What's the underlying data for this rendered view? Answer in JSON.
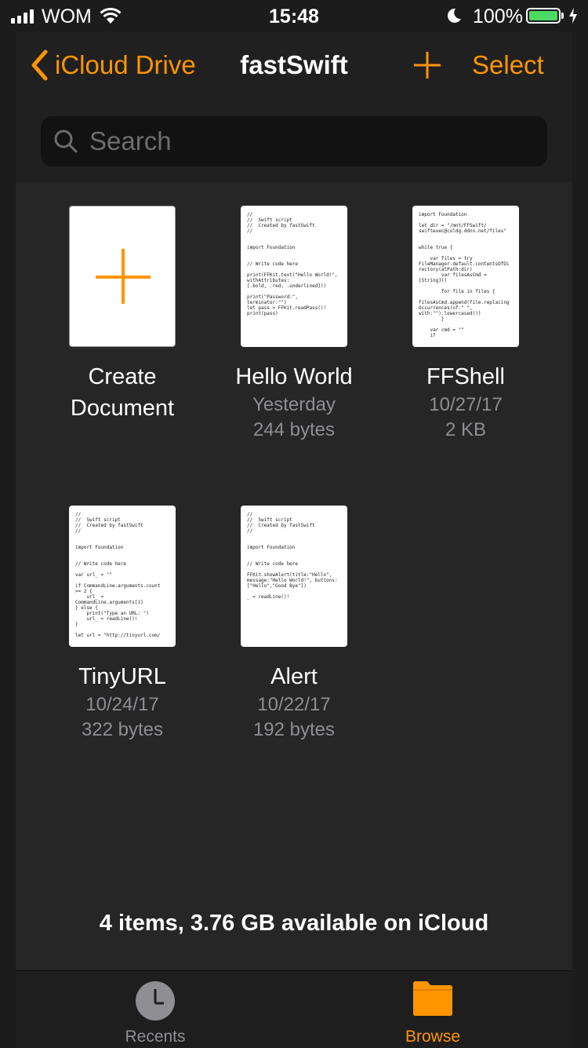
{
  "status_bar": {
    "carrier": "WOM",
    "time": "15:48",
    "battery_percent": "100%",
    "battery_level": 1.0,
    "battery_color": "#4cd964"
  },
  "nav": {
    "back_label": "iCloud Drive",
    "title": "fastSwift",
    "add_icon": "plus-icon",
    "select_label": "Select",
    "accent_color": "#ff9500"
  },
  "search": {
    "placeholder": "Search",
    "value": ""
  },
  "items": [
    {
      "name_line1": "Create",
      "name_line2": "Document",
      "icon": "plus-icon"
    },
    {
      "name": "Hello World",
      "date": "Yesterday",
      "size": "244 bytes",
      "preview": "//\n//  Swift script\n//  Created by fastSwift\n//\n\n\nimport Foundation\n\n\n// Write code here\n\nprint(FFKit.text(\"Hello World!\",\nwithAttributes:\n[.bold, .red, .underlined]))\n\nprint(\"Password:\",\nterminator:\"\")\nlet pass = FFKit.readPass()!\nprint(pass)"
    },
    {
      "name": "FFShell",
      "date": "10/27/17",
      "size": "2 KB",
      "preview": "import Foundation\n\nlet dir = \"/mnt/FFSwift/\nswiftexec@coldg.ddns.net/files\"\n\n\nwhile true {\n\n    var files = try\nFileManager.default.contentsOfDi\nrectory(atPath:dir)\n        var filesAsCmd =\n[String]()\n\n        for file in files {\n\nfilesAsCmd.append(file.replacing\nOccurrences(of:\" \",\nwith:\"\").lowercased())\n        }\n\n    var cmd = \"\"\n    if"
    },
    {
      "name": "TinyURL",
      "date": "10/24/17",
      "size": "322 bytes",
      "preview": "//\n//  Swift script\n//  Created by fastSwift\n//\n\n\nimport Foundation\n\n\n// Write code here\n\nvar url_ = \"\"\n\nif CommandLine.arguments.count\n>= 2 {\n    url_ =\nCommandLine.arguments[1]\n} else {\n    print(\"Type an URL: \")\n    url_ = readLine()!\n}\n\nlet url = \"http://tinyurl.com/"
    },
    {
      "name": "Alert",
      "date": "10/22/17",
      "size": "192 bytes",
      "preview": "//\n//  Swift script\n//  Created by fastSwift\n//\n\n\nimport Foundation\n\n\n// Write code here\n\nFFKit.showAlert(title:\"Hello\",\nmessage:\"Hello World!\", buttons:\n[\"Hello\",\"Good Bye\"])\n\n_ = readLine()!"
    }
  ],
  "footer": "4 items, 3.76 GB available on iCloud",
  "tabbar": {
    "recents_label": "Recents",
    "recents_icon": "clock-icon",
    "browse_label": "Browse",
    "browse_icon": "folder-icon",
    "active_color": "#ff9500",
    "inactive_color": "#8e8e93"
  }
}
